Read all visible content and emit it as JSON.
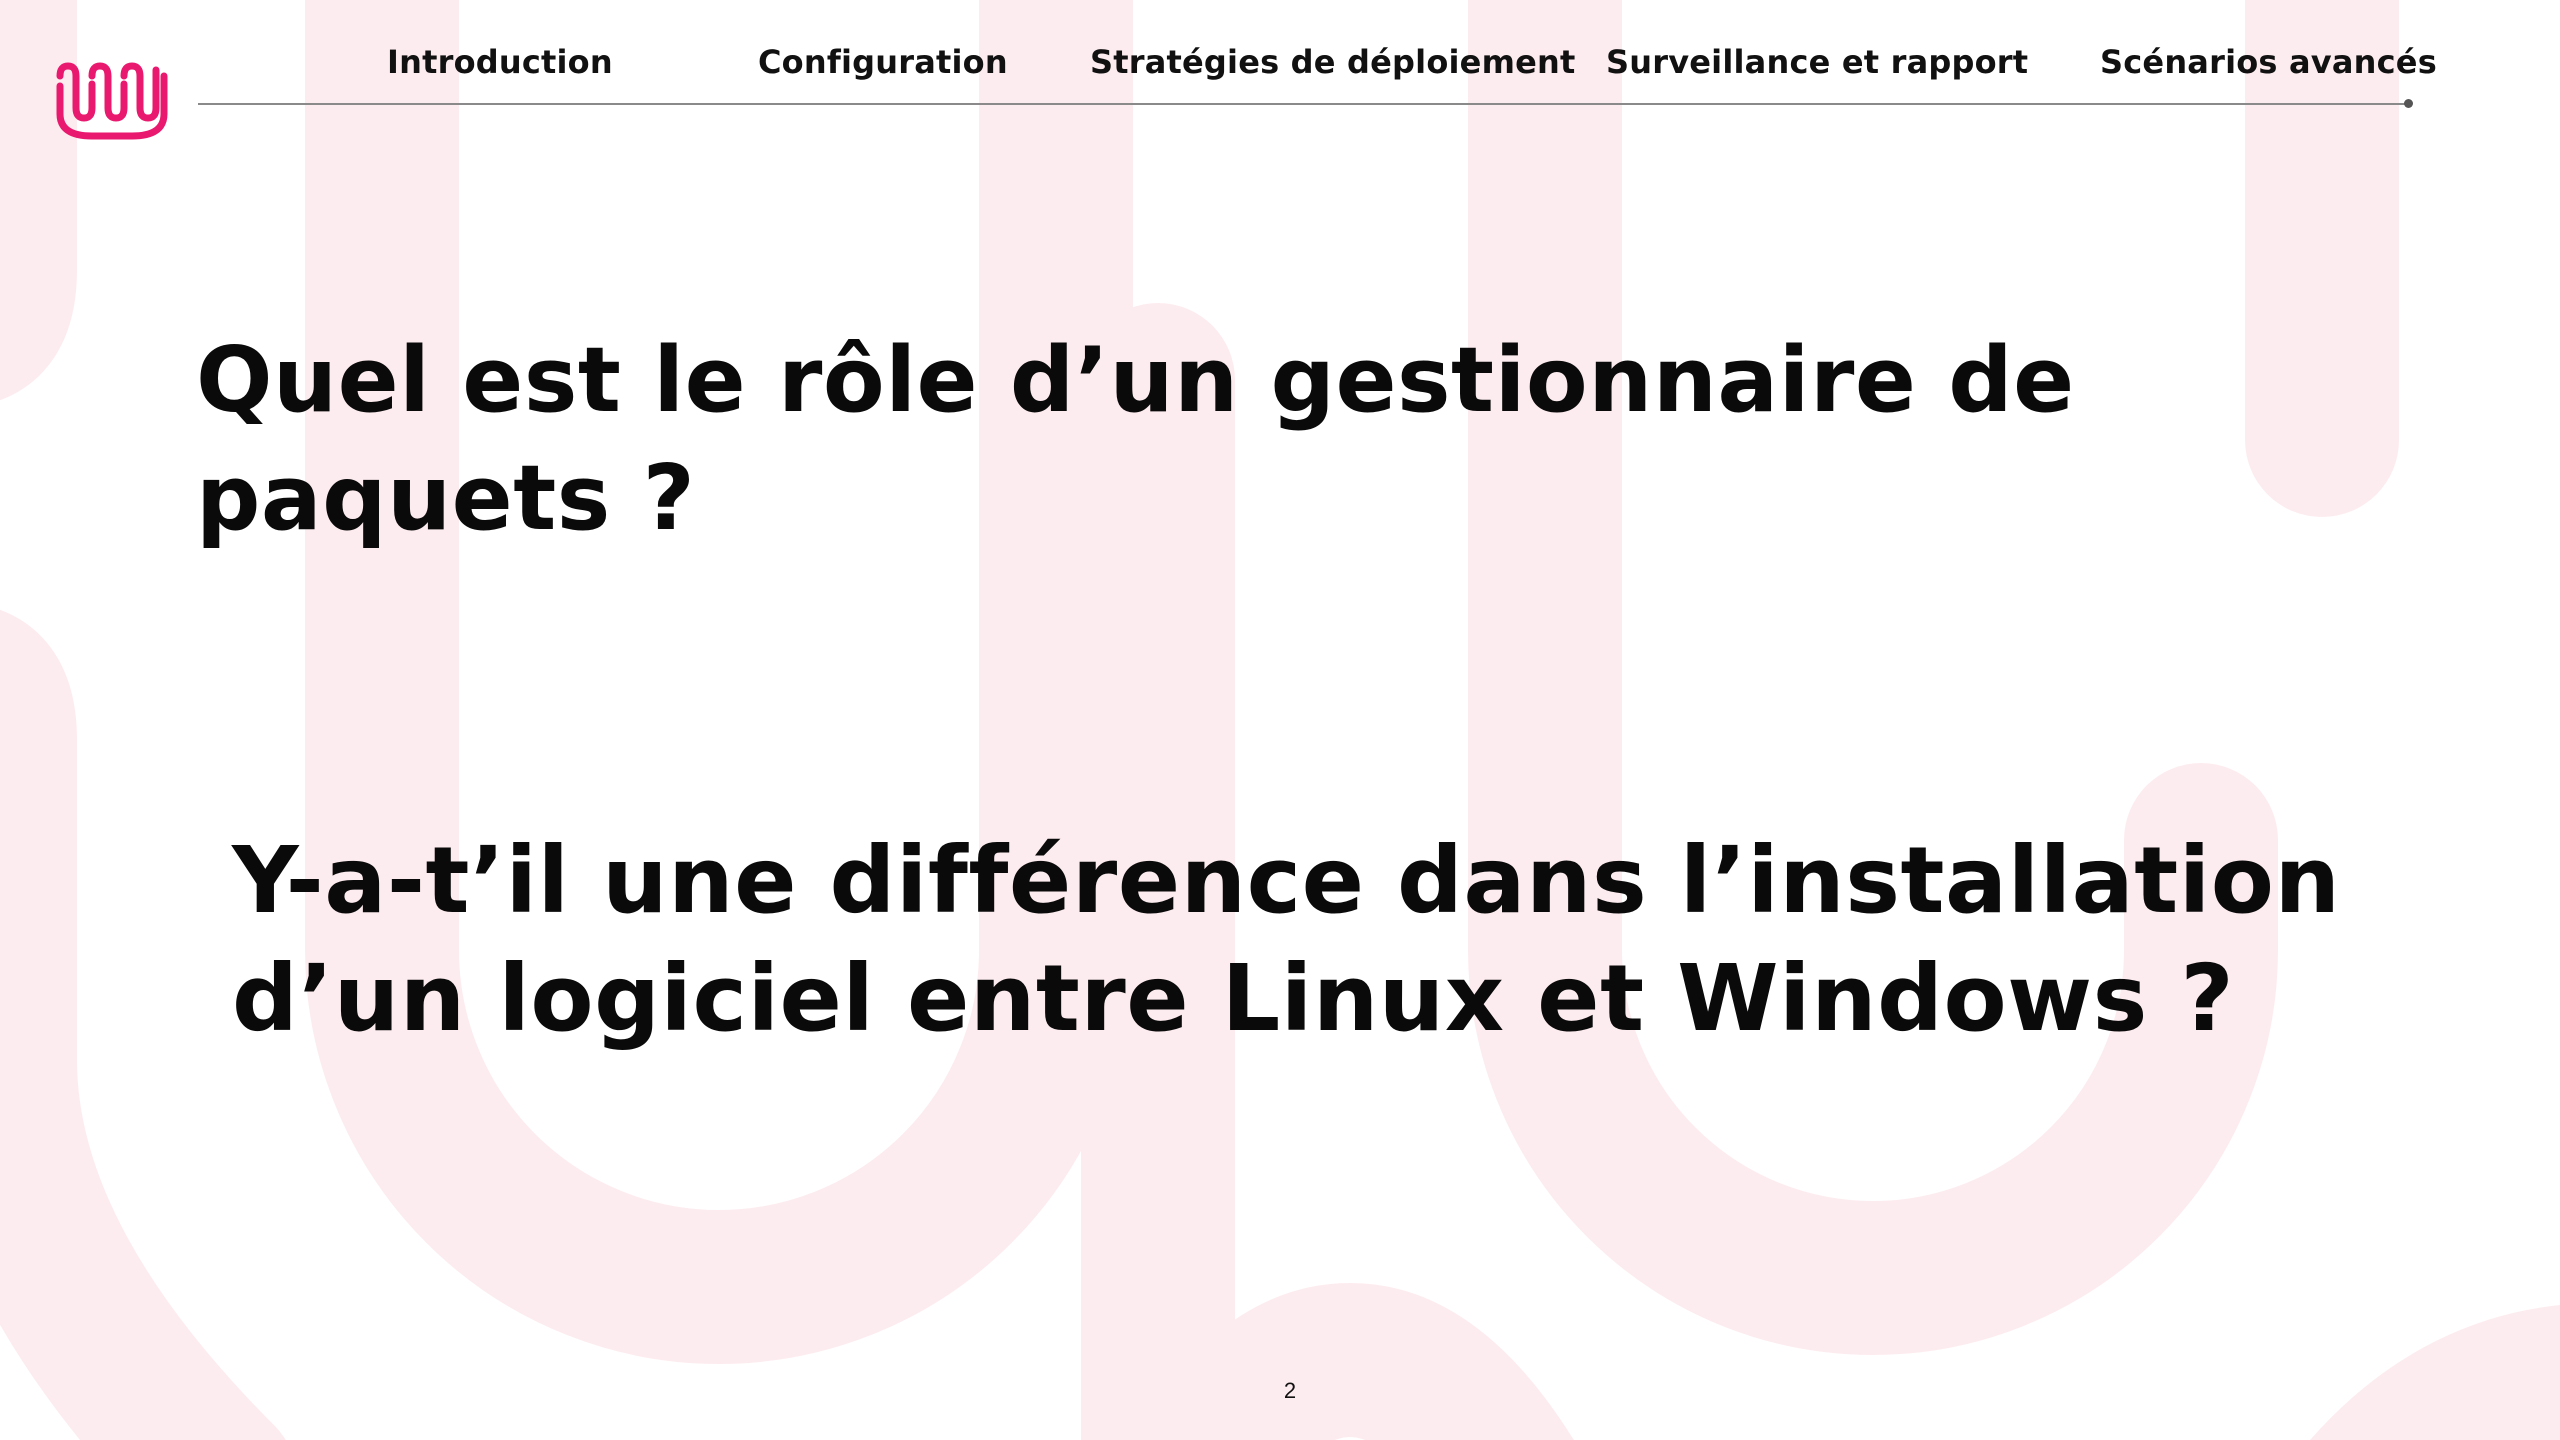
{
  "nav": {
    "items": [
      {
        "label": "Introduction"
      },
      {
        "label": "Configuration"
      },
      {
        "label": "Stratégies de déploiement"
      },
      {
        "label": "Surveillance et rapport"
      },
      {
        "label": "Scénarios avancés"
      }
    ]
  },
  "content": {
    "question_1": "Quel est le rôle d’un gestionnaire de paquets ?",
    "question_2": "Y-a-t’il une différence dans l’installation d’un logiciel entre Linux et Windows ?"
  },
  "footer": {
    "page_number": "2"
  },
  "colors": {
    "brand": "#e8196e",
    "background_pattern": "#fdecef",
    "text": "#0a0a0a",
    "divider": "#8a8a8a"
  },
  "icons": {
    "logo": "brand-logo-icon"
  }
}
